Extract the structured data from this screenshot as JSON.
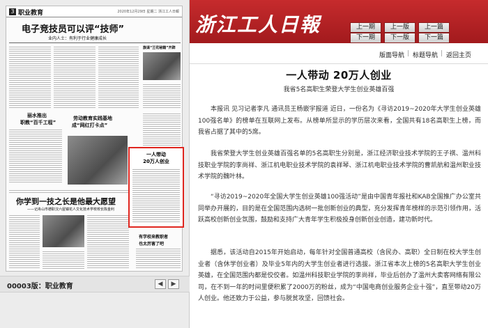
{
  "newspaper": {
    "page_number": "3",
    "section": "职业教育",
    "date_line": "2020年12月29日 星期二  浙江工人日報",
    "headlines": {
      "main": "电子竞技员可以评“技师”",
      "main_sub": "业内人士：有利于行业健康成长",
      "column_left": "丽水推出",
      "column_left2": "职教“百千工程”",
      "center": "劳动教育实践基地",
      "center2": "成“网红打卡点”",
      "top_right": "旗谋“兰花秘籍”开辟",
      "big": "你学到一技之长是他最大愿望",
      "big_sub": "——记舟山市德职汉六屋镇花人文化技术学校校长陈金利",
      "bottom_right": "有学校来教职者",
      "bottom_right2": "也太厉害了吧"
    },
    "highlight_box": {
      "line1": "一人带动",
      "line2": "20万人创业"
    }
  },
  "page_bar": {
    "label": "00003版：职业教育",
    "prev_icon": "◀",
    "next_icon": "▶"
  },
  "banner": {
    "logo": "浙江工人日報",
    "buttons": {
      "prev_article": "上一期",
      "prev_edition": "上一版",
      "prev_issue": "上一篇",
      "next_article": "下一期",
      "next_edition": "下一版",
      "next_issue": "下一篇"
    }
  },
  "subnav": {
    "layout_nav": "版面导航",
    "title_nav": "标题导航",
    "back_home": "返回主页",
    "separator": "|"
  },
  "article": {
    "title": "一人带动  20万人创业",
    "subtitle": "我省5名高职生荣登大学生创业英雄百强",
    "paragraphs": [
      "本报讯  见习记者李凡  通讯员王杨嵌宇报道    近日，一份名为《寻访2019~2020年大学生创业英雄100强名单》的榜单在互联网上发布。从榜单所显示的学历层次来看，全国共有18名高职生上榜，而我省占据了其中的5席。",
      "我省荣登大学生创业英雄百强名单的5名高职生分别是，浙江经济职业技术学院的王子祺、温州科技职业学院的李尚祥、浙江机电职业技术学院的袁祥琴、浙江机电职业技术学院的曹凯航和温州职业技术学院的魏叶林。",
      "“寻访2019~2020年全国大学生创业英雄100强活动”是由中国青年报社和KAB全国推广办公室共同举办开展的，目的是在全国范围内选树一批创新创业的典型，充分发挥青年榜样的示范引领作用，活跃高校创新创业氛围，鼓励和支持广大青年学生积极投身创新创业创造，建功新时代。",
      "据悉，该活动自2015年开始启动，每年针对全国普通高校（含民办、高职）全日制在校大学生创业者（含休学创业者）及毕业5年内的大学生创业者进行选拔。浙江省本次上榜的5名高职大学生创业英雄，在全国范围内都是佼佼者。如温州科技职业学院的李尚祥，毕业后创办了温州大卖客网络有限公司，在不到一年的时间里便积累了2000万的粉丝，成为“中国电商创业服务企业十强”，直至带动20万人创业。他还致力于公益，参与脱贫攻坚，回馈社会。"
    ]
  }
}
